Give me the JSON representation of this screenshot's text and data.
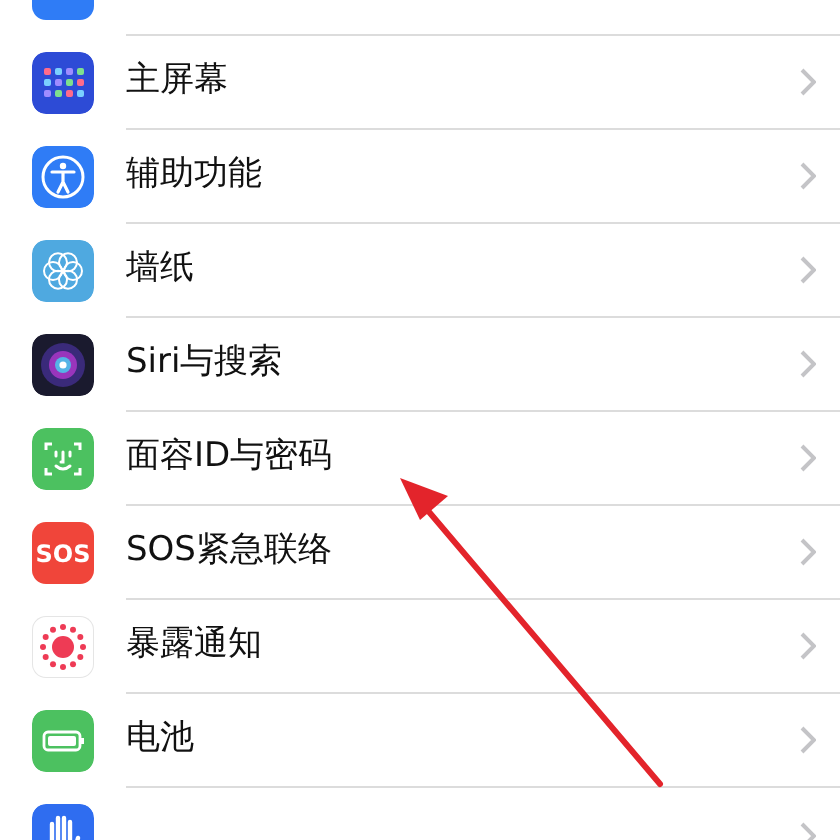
{
  "settings_list": [
    {
      "kind": "setting"
    },
    {
      "kind": "setting",
      "label": "主屏幕"
    },
    {
      "kind": "setting",
      "label": "辅助功能"
    },
    {
      "kind": "setting",
      "label": "墙纸"
    },
    {
      "kind": "setting",
      "label": "Siri与搜索"
    },
    {
      "kind": "setting",
      "label": "面容ID与密码"
    },
    {
      "kind": "setting",
      "label": "SOS紧急联络",
      "icon_text": "SOS"
    },
    {
      "kind": "setting",
      "label": "暴露通知"
    },
    {
      "kind": "setting",
      "label": "电池"
    },
    {
      "kind": "setting"
    }
  ]
}
